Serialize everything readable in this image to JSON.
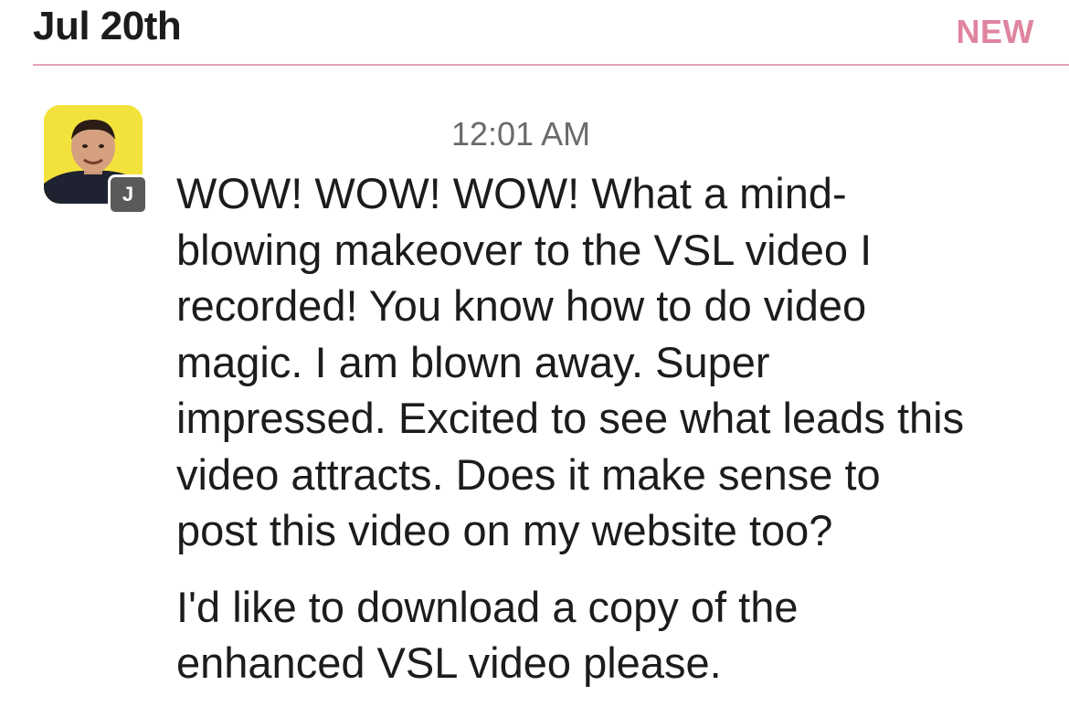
{
  "header": {
    "date": "Jul 20th",
    "new_label": "NEW"
  },
  "message": {
    "author_initial": "J",
    "timestamp": "12:01 AM",
    "paragraphs": [
      "WOW!  WOW!  WOW!  What a mind-\nblowing makeover to the VSL video I\nrecorded!  You know how to do video\nmagic.  I am blown away.  Super\nimpressed.  Excited to see what leads this\nvideo attracts.  Does it make sense to\npost this video on my website too?",
      "I'd like to download a copy of the\nenhanced VSL video please."
    ]
  },
  "colors": {
    "new_label": "#e0849f",
    "divider": "#e4a3b6",
    "avatar_bg": "#f4e23c",
    "badge_bg": "#5a5a5a"
  }
}
